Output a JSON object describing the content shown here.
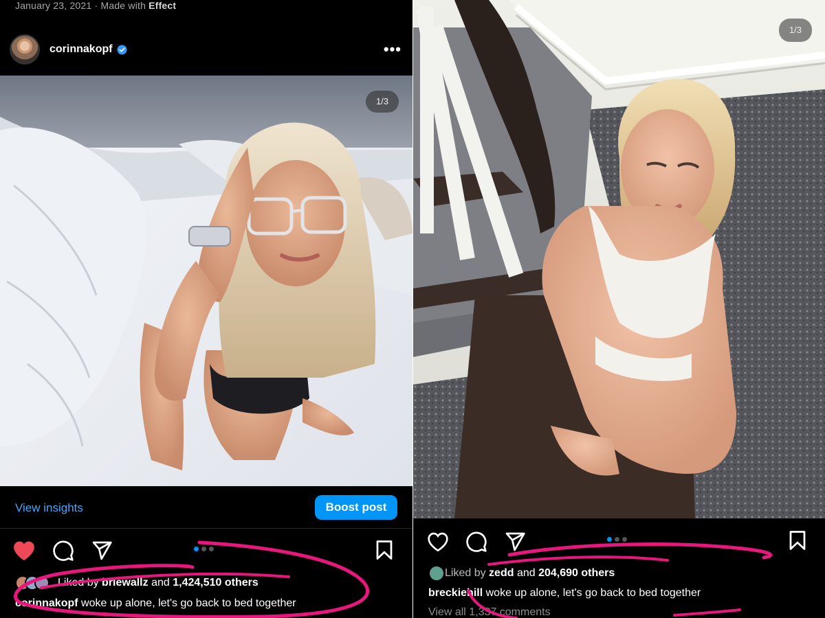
{
  "left_post": {
    "date_meta": "January 23, 2021",
    "separator": "·",
    "made_with_prefix": "Made with",
    "made_with_app": "Effect",
    "username": "corinnakopf",
    "more_icon": "•••",
    "slide_counter": "1/3",
    "view_insights": "View insights",
    "boost_post": "Boost post",
    "liked_by_prefix": "Liked by",
    "liked_by_user": "briewallz",
    "and_text": "and",
    "liked_count": "1,424,510 others",
    "caption_user": "corinnakopf",
    "caption_text": "woke up alone, let's go back to bed together"
  },
  "right_post": {
    "slide_counter": "1/3",
    "liked_by_prefix": "Liked by",
    "liked_by_user": "zedd",
    "and_text": "and",
    "liked_count": "204,690 others",
    "caption_user": "breckiehill",
    "caption_text": "woke up alone, let's go back to bed together",
    "view_comments": "View all 1,337 comments"
  },
  "icons": {
    "like_filled": "heart-filled-icon",
    "like_outline": "heart-outline-icon",
    "comment": "comment-icon",
    "share": "send-icon",
    "save": "bookmark-icon",
    "verified": "verified-badge-icon"
  },
  "colors": {
    "background": "#000000",
    "link_blue": "#4aa3f4",
    "boost_blue": "#0095f6",
    "like_red": "#ed4956",
    "annotation_pink": "#e8177e",
    "verified_blue": "#3897f0"
  }
}
